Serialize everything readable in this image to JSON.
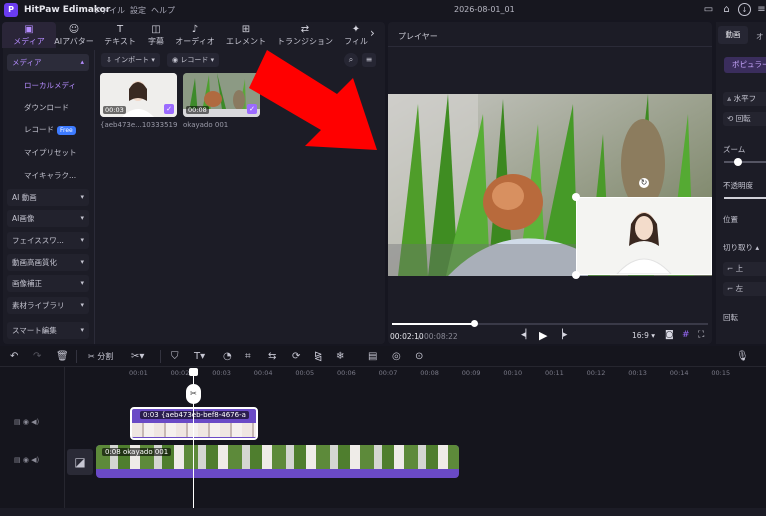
{
  "app": {
    "logo": "P",
    "name": "HitPaw Edimakor",
    "project": "2026-08-01_01"
  },
  "menu": [
    "ファイル",
    "設定",
    "ヘルプ"
  ],
  "tabs": [
    {
      "icon": "media-icon",
      "label": "メディア"
    },
    {
      "icon": "ai-avatar-icon",
      "label": "AIアバター"
    },
    {
      "icon": "text-icon",
      "label": "テキスト"
    },
    {
      "icon": "subtitle-icon",
      "label": "字幕"
    },
    {
      "icon": "audio-icon",
      "label": "オーディオ"
    },
    {
      "icon": "element-icon",
      "label": "エレメント"
    },
    {
      "icon": "transition-icon",
      "label": "トランジション"
    },
    {
      "icon": "filter-icon",
      "label": "フィル"
    }
  ],
  "sidebar": {
    "media": "メディア",
    "local_media": "ローカルメディ",
    "download": "ダウンロード",
    "record": "レコード",
    "record_badge": "Free",
    "my_preset": "マイプリセット",
    "my_character": "マイキャラク...",
    "ai_video": "AI 動画",
    "ai_image": "AI画像",
    "face_swap": "フェイススワ...",
    "video_hd": "動画高画質化",
    "image_fix": "画像補正",
    "asset_library": "素材ライブラリ",
    "smart_edit": "スマート編集"
  },
  "media_toolbar": {
    "import": "インポート",
    "record": "レコード"
  },
  "media_items": [
    {
      "time": "00:03",
      "name": "{aeb473e...10333519"
    },
    {
      "time": "00:08",
      "name": "okayado 001"
    }
  ],
  "player": {
    "label": "プレイヤー",
    "current": "00:02:10",
    "total": "00:08:22",
    "ratio": "16:9",
    "progress": 0.26
  },
  "right_panel": {
    "tab_video": "動画",
    "tab_2": "オ",
    "popular": "ポピュラー",
    "flip_h": "水平フ",
    "rotate": "回転",
    "zoom": "ズーム",
    "opacity": "不透明度",
    "position": "位置",
    "crop": "切り取り",
    "top": "上",
    "left": "左",
    "rotate2": "回転"
  },
  "timeline": {
    "split": "分割",
    "ruler": [
      "00:01",
      "00:02",
      "00:03",
      "00:04",
      "00:05",
      "00:06",
      "00:07",
      "00:08",
      "00:09",
      "00:10",
      "00:11",
      "00:12",
      "00:13",
      "00:14",
      "00:15"
    ],
    "clip_top": "0:03 {aeb473eb-bef8-4676-a",
    "clip_main": "0:08 okayado 001"
  },
  "annotation": {
    "color": "#ff0000"
  }
}
